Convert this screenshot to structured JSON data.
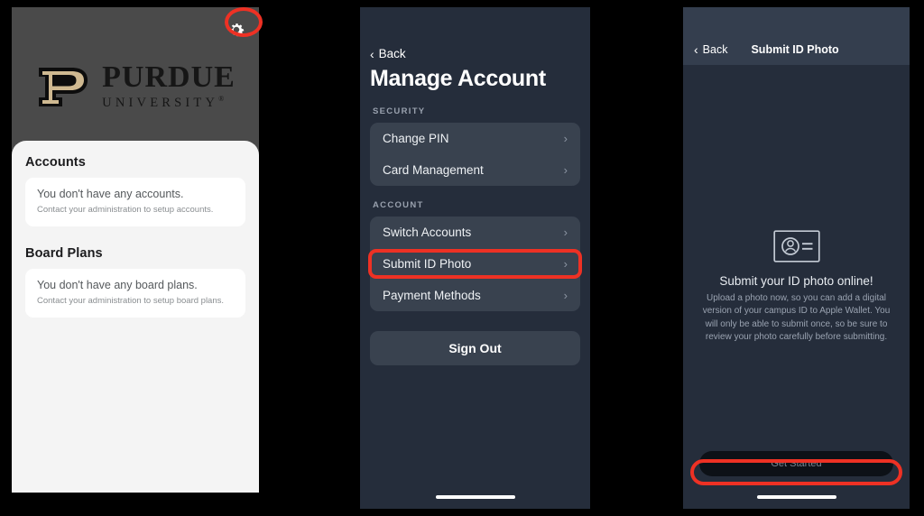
{
  "panel1": {
    "name": "home-screen",
    "gear_icon": "gear-icon",
    "logo": {
      "mark": "purdue-p-logo",
      "word": "PURDUE",
      "subword": "UNIVERSITY",
      "registered": "®"
    },
    "sections": [
      {
        "heading": "Accounts",
        "empty_title": "You don't have any accounts.",
        "empty_sub": "Contact your administration to setup accounts."
      },
      {
        "heading": "Board Plans",
        "empty_title": "You don't have any board plans.",
        "empty_sub": "Contact your administration to setup board plans."
      }
    ]
  },
  "panel2": {
    "name": "manage-account-screen",
    "back_label": "Back",
    "title": "Manage Account",
    "groups": [
      {
        "label": "SECURITY",
        "rows": [
          {
            "label": "Change PIN",
            "chevron": "chevron-right-icon"
          },
          {
            "label": "Card Management",
            "chevron": "chevron-right-icon"
          }
        ]
      },
      {
        "label": "ACCOUNT",
        "rows": [
          {
            "label": "Switch Accounts",
            "chevron": "chevron-right-icon"
          },
          {
            "label": "Submit ID Photo",
            "chevron": "chevron-right-icon",
            "highlighted": true
          },
          {
            "label": "Payment Methods",
            "chevron": "chevron-right-icon"
          }
        ]
      }
    ],
    "sign_out_label": "Sign Out"
  },
  "panel3": {
    "name": "submit-id-photo-screen",
    "back_label": "Back",
    "nav_title": "Submit ID Photo",
    "icon": "id-card-icon",
    "headline": "Submit your ID photo online!",
    "body": "Upload a photo now, so you can add a digital version of your campus ID to Apple Wallet. You will only be able to submit once, so be sure to review your photo carefully before submitting.",
    "cta_label": "Get Started"
  },
  "colors": {
    "annotation_red": "#ee3124",
    "purdue_gold": "#cfb991",
    "panel1_bg": "#4a4a4a",
    "sheet_bg": "#f4f4f4",
    "panel_dark_bg": "#252d3b",
    "row_bg": "#39424f",
    "navbar_bg": "#343e4e"
  }
}
